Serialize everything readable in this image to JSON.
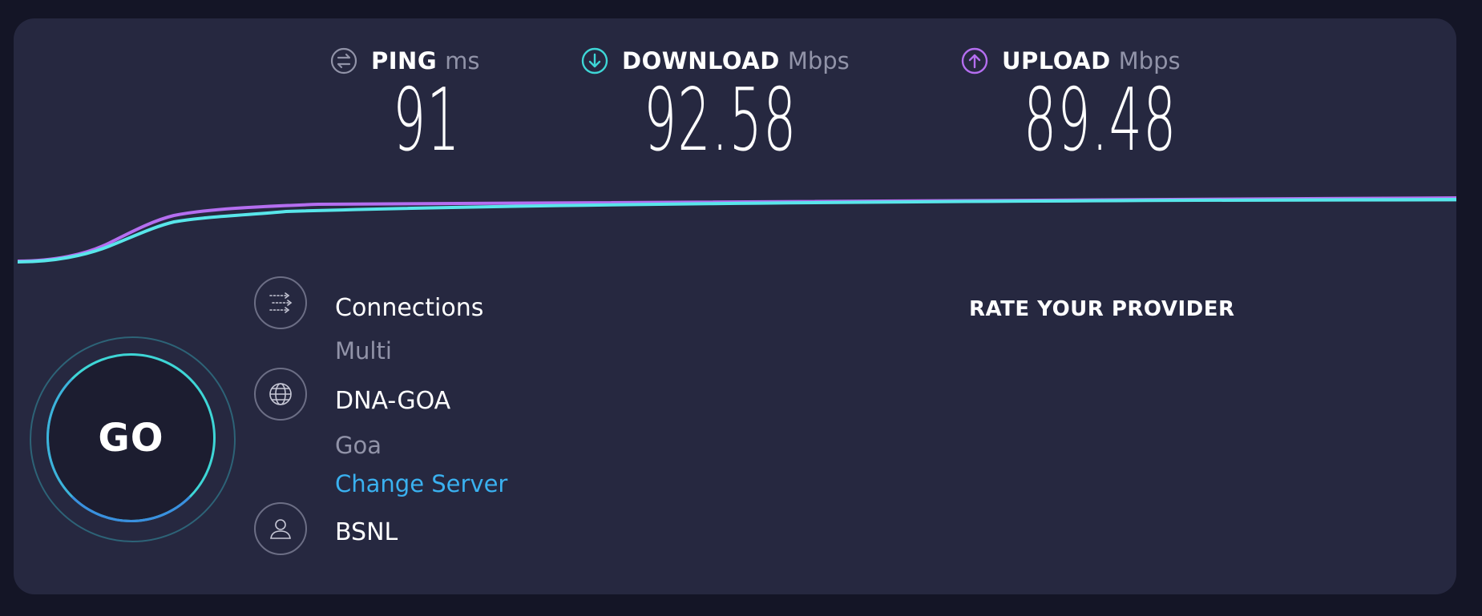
{
  "metrics": {
    "ping": {
      "label": "PING",
      "unit": "ms",
      "value": "91",
      "icon": "ping-icon"
    },
    "download": {
      "label": "DOWNLOAD",
      "unit": "Mbps",
      "value": "92.58",
      "icon": "download-arrow-icon"
    },
    "upload": {
      "label": "UPLOAD",
      "unit": "Mbps",
      "value": "89.48",
      "icon": "upload-arrow-icon"
    }
  },
  "go_button": {
    "label": "GO"
  },
  "connections": {
    "title": "Connections",
    "value": "Multi",
    "icon": "connections-icon"
  },
  "server": {
    "name": "DNA-GOA",
    "location": "Goa",
    "change_label": "Change Server",
    "icon": "globe-icon"
  },
  "provider": {
    "name": "BSNL",
    "icon": "user-icon"
  },
  "rate_provider": {
    "label": "RATE YOUR PROVIDER"
  },
  "colors": {
    "background": "#141526",
    "panel": "#262840",
    "download_accent": "#3ed6d6",
    "upload_accent": "#b46ef0",
    "link": "#3ab1f0",
    "muted_text": "#9193a8"
  }
}
